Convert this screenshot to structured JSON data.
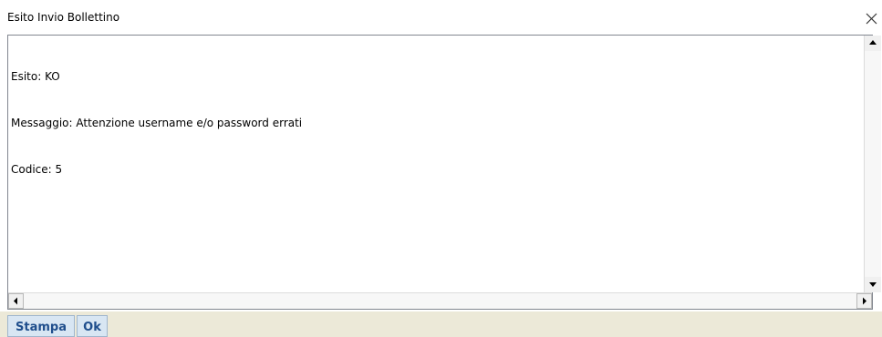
{
  "window": {
    "title": "Esito Invio Bollettino",
    "close_icon": "close-icon"
  },
  "result_text": {
    "lines": [
      "Esito: KO",
      "Messaggio: Attenzione username e/o password errati",
      "Codice: 5"
    ]
  },
  "scrollbars": {
    "vertical_icons": [
      "arrow-up-icon",
      "arrow-down-icon"
    ],
    "horizontal_icons": [
      "arrow-left-icon",
      "arrow-right-icon"
    ]
  },
  "footer": {
    "print_label": "Stampa",
    "ok_label": "Ok"
  },
  "colors": {
    "button_text": "#1f4e8c",
    "button_bg": "#d8e6f3",
    "footer_bg": "#ece9d8"
  }
}
